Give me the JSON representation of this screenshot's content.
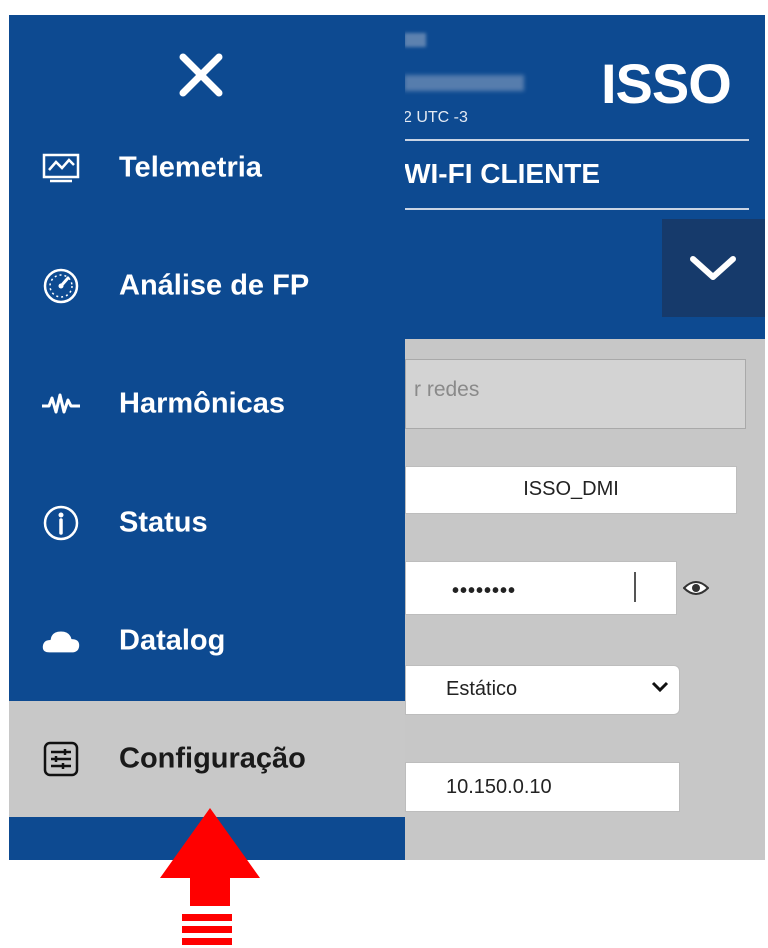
{
  "header": {
    "timezone": "2 UTC -3",
    "brand": "ISSO",
    "section_title": ") WI-FI CLIENTE"
  },
  "form": {
    "scan_networks_partial": "r redes",
    "ssid_value": "ISSO_DMI",
    "password_masked": "••••••••",
    "ip_mode_value": "Estático",
    "ip_address_value": "10.150.0.10"
  },
  "menu": {
    "items": [
      {
        "label": "Telemetria",
        "icon": "monitor-chart-icon"
      },
      {
        "label": "Análise de FP",
        "icon": "gauge-icon"
      },
      {
        "label": "Harmônicas",
        "icon": "waveform-icon"
      },
      {
        "label": "Status",
        "icon": "info-icon"
      },
      {
        "label": "Datalog",
        "icon": "cloud-icon"
      },
      {
        "label": "Configuração",
        "icon": "sliders-icon",
        "active": true
      }
    ]
  },
  "colors": {
    "menu_bg": "#0d4a91",
    "active_item_bg": "#c8c8c8",
    "annotation_arrow": "#ff0000"
  }
}
